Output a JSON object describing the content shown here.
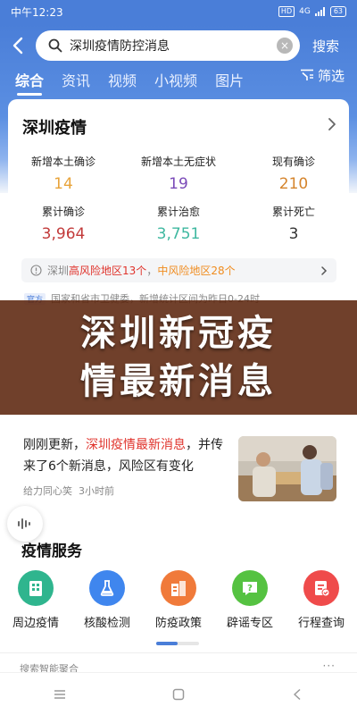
{
  "status_bar": {
    "time": "中午12:23",
    "hd": "HD",
    "network": "4G",
    "battery": "63"
  },
  "search": {
    "query": "深圳疫情防控消息",
    "search_label": "搜索"
  },
  "tabs": [
    "综合",
    "资讯",
    "视频",
    "小视频",
    "图片"
  ],
  "filter_label": "筛选",
  "epidemic_card": {
    "title": "深圳疫情",
    "stats": [
      {
        "label": "新增本土确诊",
        "value": "14",
        "color": "#e8a33a"
      },
      {
        "label": "新增本土无症状",
        "value": "19",
        "color": "#7a4ab8"
      },
      {
        "label": "现有确诊",
        "value": "210",
        "color": "#d5842c"
      },
      {
        "label": "累计确诊",
        "value": "3,964",
        "color": "#c23a3a"
      },
      {
        "label": "累计治愈",
        "value": "3,751",
        "color": "#3fb8a0"
      },
      {
        "label": "累计死亡",
        "value": "3",
        "color": "#333333"
      }
    ],
    "risk": {
      "city": "深圳",
      "high": "高风险地区13个",
      "sep": "，",
      "mid": "中风险地区28个"
    },
    "gov_badge": "官方",
    "gov_text": "国家和省市卫健委，新增统计区间为昨日0-24时"
  },
  "overlay": {
    "line1": "深圳新冠疫",
    "line2": "情最新消息"
  },
  "news": {
    "prefix": "刚刚更新，",
    "highlight": "深圳疫情最新消息",
    "suffix": "，并传来了6个新消息，风险区有变化",
    "source": "给力同心笑",
    "time": "3小时前"
  },
  "services": {
    "title": "疫情服务",
    "items": [
      {
        "label": "周边疫情",
        "icon": "building-icon",
        "color": "#2fb58e"
      },
      {
        "label": "核酸检测",
        "icon": "test-tube-icon",
        "color": "#3f86ee"
      },
      {
        "label": "防疫政策",
        "icon": "policy-building-icon",
        "color": "#f07a3a"
      },
      {
        "label": "辟谣专区",
        "icon": "question-icon",
        "color": "#55c241"
      },
      {
        "label": "行程查询",
        "icon": "itinerary-check-icon",
        "color": "#ef4b4b"
      }
    ]
  },
  "bottom": {
    "smart_agg": "搜索智能聚合",
    "more": "···"
  },
  "colors": {
    "brand_blue": "#4a7ed8",
    "risk_high": "#e0332c",
    "risk_mid": "#f08c1f",
    "overlay_brown": "#5c260e"
  }
}
